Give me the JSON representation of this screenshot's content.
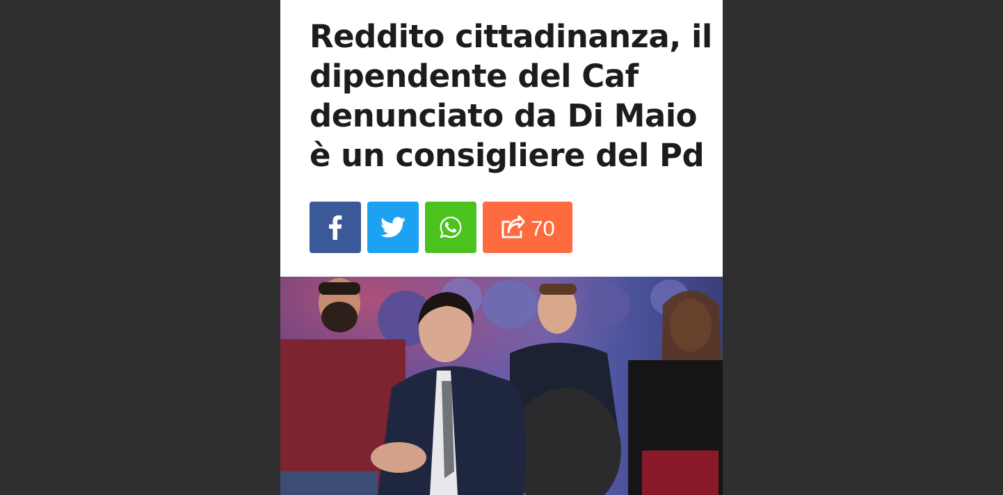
{
  "article": {
    "headline": "Reddito cittadinanza, il dipendente del Caf denunciato da Di Maio è un consigliere del Pd"
  },
  "share": {
    "buttons": [
      {
        "network": "facebook",
        "icon": "facebook-icon",
        "color": "#3b5998"
      },
      {
        "network": "twitter",
        "icon": "twitter-icon",
        "color": "#1da1f2"
      },
      {
        "network": "whatsapp",
        "icon": "whatsapp-icon",
        "color": "#4cc21f"
      },
      {
        "network": "share",
        "icon": "share-icon",
        "color": "#fd6b3e"
      }
    ],
    "count": "70"
  },
  "colors": {
    "background": "#2f2f2f",
    "page": "#ffffff",
    "headline": "#1c1c1c"
  }
}
